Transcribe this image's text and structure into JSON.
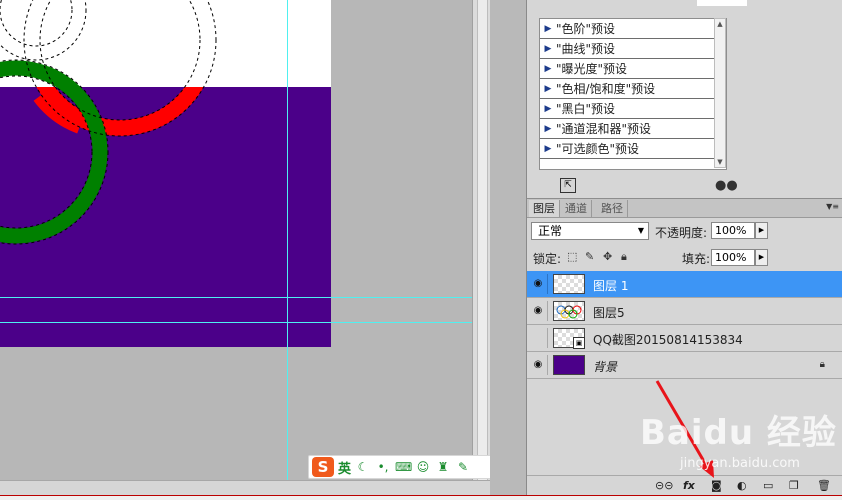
{
  "adjustments": {
    "presets": [
      "\"色阶\"预设",
      "\"曲线\"预设",
      "\"曝光度\"预设",
      "\"色相/饱和度\"预设",
      "\"黑白\"预设",
      "\"通道混和器\"预设",
      "\"可选颜色\"预设"
    ]
  },
  "layers_panel": {
    "tabs": [
      "图层",
      "通道",
      "路径"
    ],
    "blend_mode": "正常",
    "opacity_label": "不透明度:",
    "opacity_value": "100%",
    "lock_label": "锁定:",
    "fill_label": "填充:",
    "fill_value": "100%",
    "layers": [
      {
        "name": "图层 1",
        "selected": true
      },
      {
        "name": "图层5",
        "selected": false
      },
      {
        "name": "QQ截图20150814153834",
        "selected": false
      },
      {
        "name": "背景",
        "selected": false
      }
    ]
  },
  "ime": {
    "logo": "S",
    "lang": "英"
  },
  "watermark": {
    "text": "Baidu 经验",
    "sub": "jingyan.baidu.com"
  },
  "colors": {
    "selection": "#3d95f5",
    "doc_background": "#4b0089",
    "ring_red": "#ff0000",
    "ring_green": "#008000",
    "guide": "#4ff0f0"
  }
}
